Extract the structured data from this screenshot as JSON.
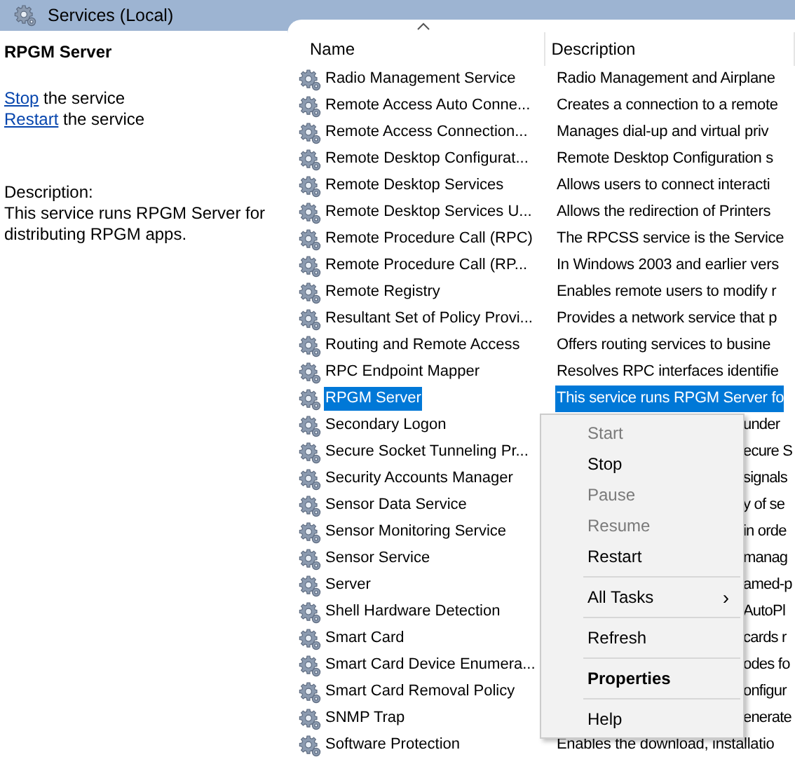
{
  "title_bar": {
    "title": "Services (Local)"
  },
  "details": {
    "service_name": "RPGM Server",
    "actions": [
      {
        "link": "Stop",
        "rest": " the service"
      },
      {
        "link": "Restart",
        "rest": " the service"
      }
    ],
    "description_label": "Description:",
    "description": "This service runs RPGM Server for distributing RPGM apps."
  },
  "table": {
    "columns": [
      {
        "label": "Name",
        "sorted": true
      },
      {
        "label": "Description",
        "sorted": false
      }
    ],
    "rows": [
      {
        "name": "Radio Management Service",
        "description": "Radio Management and Airplane",
        "selected": false,
        "partial": false
      },
      {
        "name": "Remote Access Auto Conne...",
        "description": "Creates a connection to a remote",
        "selected": false,
        "partial": false
      },
      {
        "name": "Remote Access Connection...",
        "description": "Manages dial-up and virtual priv",
        "selected": false,
        "partial": false
      },
      {
        "name": "Remote Desktop Configurat...",
        "description": "Remote Desktop Configuration s",
        "selected": false,
        "partial": false
      },
      {
        "name": "Remote Desktop Services",
        "description": "Allows users to connect interacti",
        "selected": false,
        "partial": false
      },
      {
        "name": "Remote Desktop Services U...",
        "description": "Allows the redirection of Printers",
        "selected": false,
        "partial": false
      },
      {
        "name": "Remote Procedure Call (RPC)",
        "description": "The RPCSS service is the Service",
        "selected": false,
        "partial": false
      },
      {
        "name": "Remote Procedure Call (RP...",
        "description": "In Windows 2003 and earlier vers",
        "selected": false,
        "partial": false
      },
      {
        "name": "Remote Registry",
        "description": "Enables remote users to modify r",
        "selected": false,
        "partial": false
      },
      {
        "name": "Resultant Set of Policy Provi...",
        "description": "Provides a network service that p",
        "selected": false,
        "partial": false
      },
      {
        "name": "Routing and Remote Access",
        "description": "Offers routing services to busine",
        "selected": false,
        "partial": false
      },
      {
        "name": "RPC Endpoint Mapper",
        "description": "Resolves RPC interfaces identifie",
        "selected": false,
        "partial": false
      },
      {
        "name": "RPGM Server",
        "description": "This service runs RPGM Server fo",
        "selected": true,
        "partial": false
      },
      {
        "name": "Secondary Logon",
        "description": "under",
        "selected": false,
        "partial": true
      },
      {
        "name": "Secure Socket Tunneling Pr...",
        "description": "ecure S",
        "selected": false,
        "partial": true
      },
      {
        "name": "Security Accounts Manager",
        "description": "signals",
        "selected": false,
        "partial": true
      },
      {
        "name": "Sensor Data Service",
        "description": "y of se",
        "selected": false,
        "partial": true
      },
      {
        "name": "Sensor Monitoring Service",
        "description": "in orde",
        "selected": false,
        "partial": true
      },
      {
        "name": "Sensor Service",
        "description": "manag",
        "selected": false,
        "partial": true
      },
      {
        "name": "Server",
        "description": "amed-p",
        "selected": false,
        "partial": true
      },
      {
        "name": "Shell Hardware Detection",
        "description": "AutoPl",
        "selected": false,
        "partial": true
      },
      {
        "name": "Smart Card",
        "description": "cards r",
        "selected": false,
        "partial": true
      },
      {
        "name": "Smart Card Device Enumera...",
        "description": "odes fo",
        "selected": false,
        "partial": true
      },
      {
        "name": "Smart Card Removal Policy",
        "description": "onfigur",
        "selected": false,
        "partial": true
      },
      {
        "name": "SNMP Trap",
        "description": "enerate",
        "selected": false,
        "partial": true
      },
      {
        "name": "Software Protection",
        "description": "Enables the download, installatio",
        "selected": false,
        "partial": false
      }
    ]
  },
  "context_menu": {
    "items": [
      {
        "kind": "item",
        "label": "Start",
        "disabled": true,
        "bold": false
      },
      {
        "kind": "item",
        "label": "Stop",
        "disabled": false,
        "bold": false
      },
      {
        "kind": "item",
        "label": "Pause",
        "disabled": true,
        "bold": false
      },
      {
        "kind": "item",
        "label": "Resume",
        "disabled": true,
        "bold": false
      },
      {
        "kind": "item",
        "label": "Restart",
        "disabled": false,
        "bold": false
      },
      {
        "kind": "separator"
      },
      {
        "kind": "submenu",
        "label": "All Tasks",
        "arrow": "›",
        "disabled": false,
        "bold": false
      },
      {
        "kind": "separator"
      },
      {
        "kind": "item",
        "label": "Refresh",
        "disabled": false,
        "bold": false
      },
      {
        "kind": "separator"
      },
      {
        "kind": "item",
        "label": "Properties",
        "disabled": false,
        "bold": true
      },
      {
        "kind": "separator"
      },
      {
        "kind": "item",
        "label": "Help",
        "disabled": false,
        "bold": false
      }
    ]
  }
}
